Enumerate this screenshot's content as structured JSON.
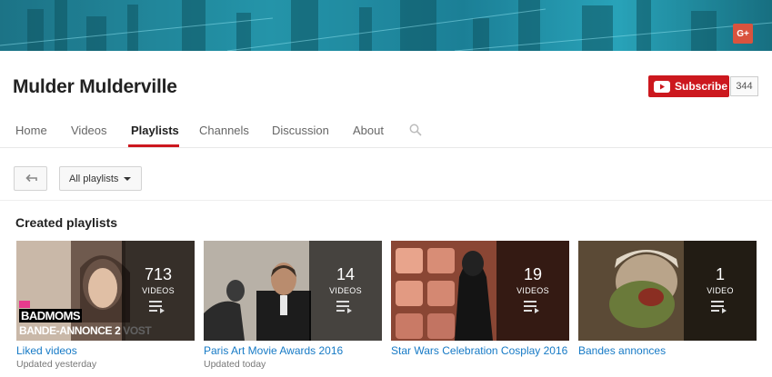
{
  "channel": {
    "name": "Mulder Mulderville",
    "subscribe_label": "Subscribe",
    "subscriber_count": "344",
    "gplus_label": "G+"
  },
  "tabs": [
    {
      "label": "Home"
    },
    {
      "label": "Videos"
    },
    {
      "label": "Playlists"
    },
    {
      "label": "Channels"
    },
    {
      "label": "Discussion"
    },
    {
      "label": "About"
    }
  ],
  "filter": {
    "selected": "All playlists"
  },
  "section_title": "Created playlists",
  "playlists": [
    {
      "title": "Liked videos",
      "count": "713",
      "count_label": "VIDEOS",
      "updated": "Updated yesterday",
      "thumb_text_1": "BADMOMS",
      "thumb_text_2": "BANDE-ANNONCE 2 VOST"
    },
    {
      "title": "Paris Art Movie Awards 2016",
      "count": "14",
      "count_label": "VIDEOS",
      "updated": "Updated today"
    },
    {
      "title": "Star Wars Celebration Cosplay 2016",
      "count": "19",
      "count_label": "VIDEOS",
      "updated": ""
    },
    {
      "title": "Bandes annonces",
      "count": "1",
      "count_label": "VIDEO",
      "updated": ""
    }
  ],
  "colors": {
    "accent": "#cc181e",
    "link": "#167ac6",
    "banner": "#1f8ea3"
  },
  "icons": {
    "gplus": "google-plus-icon",
    "subscribe": "youtube-play-icon",
    "search": "search-icon",
    "back": "back-arrow-icon",
    "dropdown": "caret-down-icon",
    "playlist": "playlist-icon"
  }
}
